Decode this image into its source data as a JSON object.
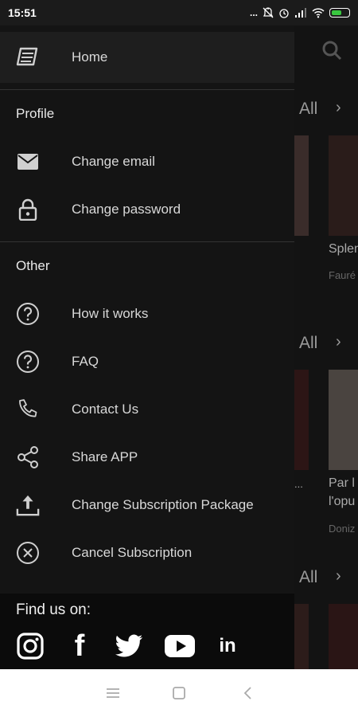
{
  "status": {
    "time": "15:51",
    "dots": "..."
  },
  "background": {
    "see_all_1": "All",
    "see_all_2": "All",
    "see_all_3": "All",
    "card1_title": "Splen",
    "card1_sub": "Fauré",
    "card2_title_1": "Par l",
    "card2_title_2": "l'opu",
    "card2_sub": "Doniz",
    "ellipsis": "..."
  },
  "drawer": {
    "home": {
      "label": "Home",
      "icon": "book-icon"
    },
    "profile": {
      "title": "Profile",
      "items": [
        {
          "label": "Change email",
          "icon": "envelope-icon"
        },
        {
          "label": "Change password",
          "icon": "lock-icon"
        }
      ]
    },
    "other": {
      "title": "Other",
      "items": [
        {
          "label": "How it works",
          "icon": "question-circle-icon"
        },
        {
          "label": "FAQ",
          "icon": "question-circle-icon"
        },
        {
          "label": "Contact Us",
          "icon": "phone-icon"
        },
        {
          "label": "Share APP",
          "icon": "share-icon"
        },
        {
          "label": "Change Subscription Package",
          "icon": "upload-icon"
        },
        {
          "label": "Cancel Subscription",
          "icon": "close-circle-icon"
        }
      ]
    },
    "footer": {
      "find_us": "Find us on:",
      "social": [
        "instagram-icon",
        "facebook-icon",
        "twitter-icon",
        "youtube-icon",
        "linkedin-icon"
      ],
      "linkedin_text": "in",
      "facebook_text": "f"
    }
  },
  "colors": {
    "drawer_bg": "#141414",
    "battery_green": "#39c73f"
  }
}
